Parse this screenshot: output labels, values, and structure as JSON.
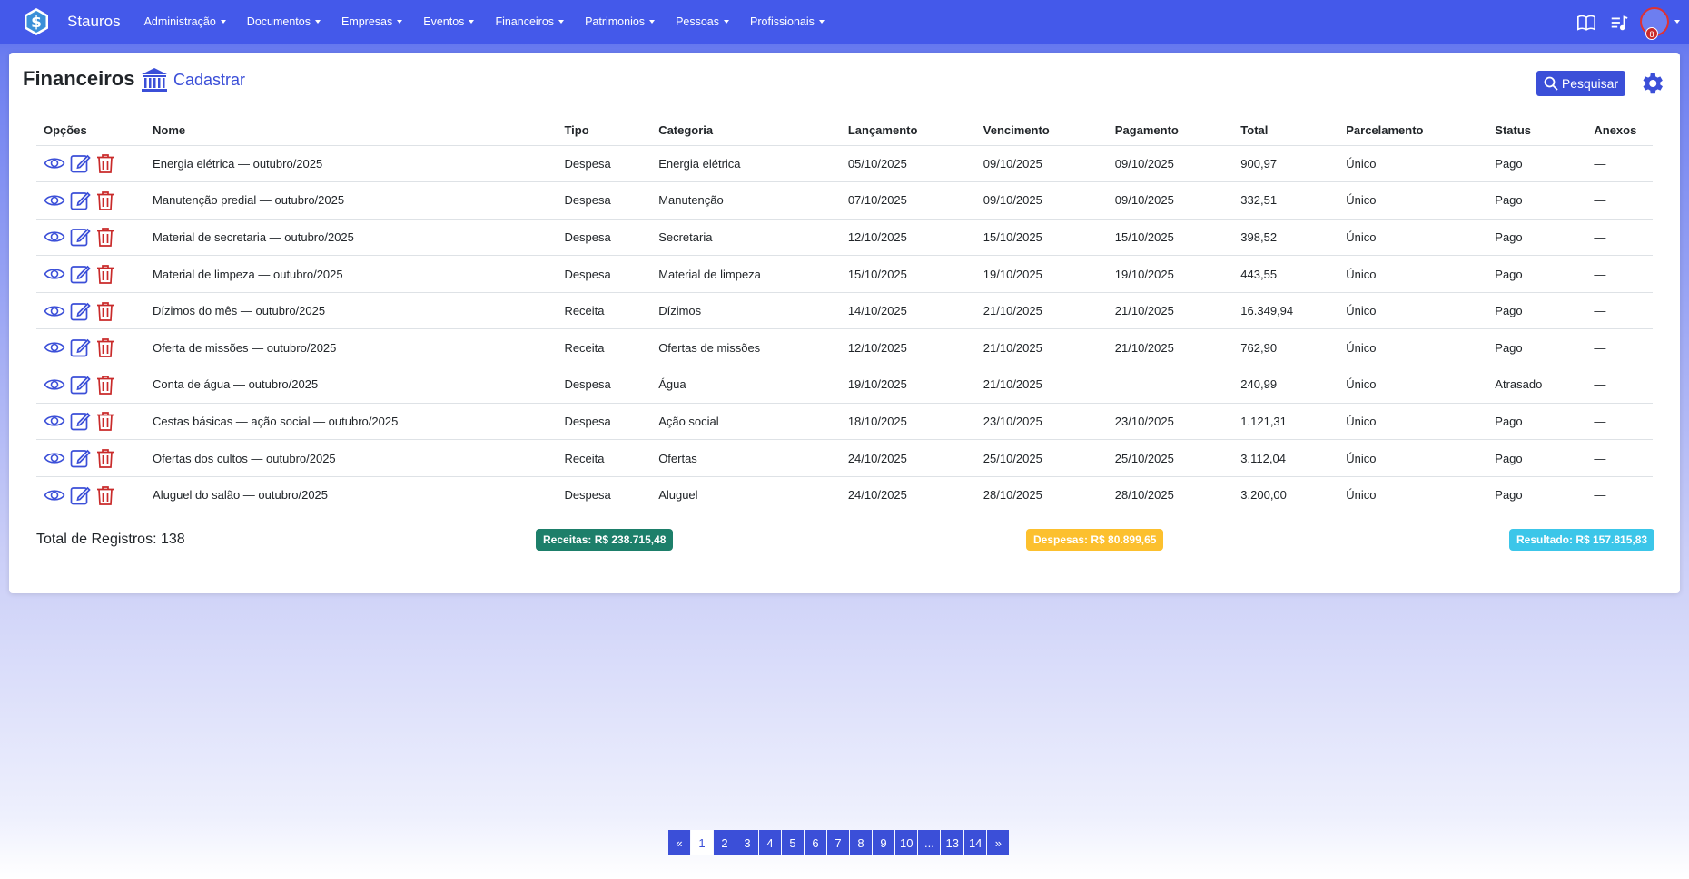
{
  "nav": {
    "brand": "Stauros",
    "menu": [
      "Administração",
      "Documentos",
      "Empresas",
      "Eventos",
      "Financeiros",
      "Patrimonios",
      "Pessoas",
      "Profissionais"
    ],
    "notification_count": "8"
  },
  "header": {
    "title": "Financeiros",
    "add_label": "Cadastrar",
    "search_label": "Pesquisar"
  },
  "table": {
    "columns": [
      "Opções",
      "Nome",
      "Tipo",
      "Categoria",
      "Lançamento",
      "Vencimento",
      "Pagamento",
      "Total",
      "Parcelamento",
      "Status",
      "Anexos"
    ],
    "rows": [
      {
        "nome": "Energia elétrica — outubro/2025",
        "tipo": "Despesa",
        "categoria": "Energia elétrica",
        "lancamento": "05/10/2025",
        "vencimento": "09/10/2025",
        "pagamento": "09/10/2025",
        "total": "900,97",
        "parcelamento": "Único",
        "status": "Pago",
        "anexos": "—"
      },
      {
        "nome": "Manutenção predial — outubro/2025",
        "tipo": "Despesa",
        "categoria": "Manutenção",
        "lancamento": "07/10/2025",
        "vencimento": "09/10/2025",
        "pagamento": "09/10/2025",
        "total": "332,51",
        "parcelamento": "Único",
        "status": "Pago",
        "anexos": "—"
      },
      {
        "nome": "Material de secretaria — outubro/2025",
        "tipo": "Despesa",
        "categoria": "Secretaria",
        "lancamento": "12/10/2025",
        "vencimento": "15/10/2025",
        "pagamento": "15/10/2025",
        "total": "398,52",
        "parcelamento": "Único",
        "status": "Pago",
        "anexos": "—"
      },
      {
        "nome": "Material de limpeza — outubro/2025",
        "tipo": "Despesa",
        "categoria": "Material de limpeza",
        "lancamento": "15/10/2025",
        "vencimento": "19/10/2025",
        "pagamento": "19/10/2025",
        "total": "443,55",
        "parcelamento": "Único",
        "status": "Pago",
        "anexos": "—"
      },
      {
        "nome": "Dízimos do mês — outubro/2025",
        "tipo": "Receita",
        "categoria": "Dízimos",
        "lancamento": "14/10/2025",
        "vencimento": "21/10/2025",
        "pagamento": "21/10/2025",
        "total": "16.349,94",
        "parcelamento": "Único",
        "status": "Pago",
        "anexos": "—"
      },
      {
        "nome": "Oferta de missões — outubro/2025",
        "tipo": "Receita",
        "categoria": "Ofertas de missões",
        "lancamento": "12/10/2025",
        "vencimento": "21/10/2025",
        "pagamento": "21/10/2025",
        "total": "762,90",
        "parcelamento": "Único",
        "status": "Pago",
        "anexos": "—"
      },
      {
        "nome": "Conta de água — outubro/2025",
        "tipo": "Despesa",
        "categoria": "Água",
        "lancamento": "19/10/2025",
        "vencimento": "21/10/2025",
        "pagamento": "",
        "total": "240,99",
        "parcelamento": "Único",
        "status": "Atrasado",
        "anexos": "—"
      },
      {
        "nome": "Cestas básicas — ação social — outubro/2025",
        "tipo": "Despesa",
        "categoria": "Ação social",
        "lancamento": "18/10/2025",
        "vencimento": "23/10/2025",
        "pagamento": "23/10/2025",
        "total": "1.121,31",
        "parcelamento": "Único",
        "status": "Pago",
        "anexos": "—"
      },
      {
        "nome": "Ofertas dos cultos — outubro/2025",
        "tipo": "Receita",
        "categoria": "Ofertas",
        "lancamento": "24/10/2025",
        "vencimento": "25/10/2025",
        "pagamento": "25/10/2025",
        "total": "3.112,04",
        "parcelamento": "Único",
        "status": "Pago",
        "anexos": "—"
      },
      {
        "nome": "Aluguel do salão — outubro/2025",
        "tipo": "Despesa",
        "categoria": "Aluguel",
        "lancamento": "24/10/2025",
        "vencimento": "28/10/2025",
        "pagamento": "28/10/2025",
        "total": "3.200,00",
        "parcelamento": "Único",
        "status": "Pago",
        "anexos": "—"
      }
    ]
  },
  "summary": {
    "total_registros": "Total de Registros: 138",
    "receitas": "Receitas: R$ 238.715,48",
    "despesas": "Despesas: R$ 80.899,65",
    "resultado": "Resultado: R$ 157.815,83"
  },
  "pagination": {
    "pages": [
      "«",
      "1",
      "2",
      "3",
      "4",
      "5",
      "6",
      "7",
      "8",
      "9",
      "10",
      "...",
      "13",
      "14",
      "»"
    ],
    "active": "1"
  },
  "colors": {
    "primary": "#3b4fd8",
    "navbar": "#4459ea",
    "delete": "#c92a2a",
    "receitas_badge": "#1d7f6a",
    "despesas_badge": "#fcc02e",
    "resultado_badge": "#3cc6e9"
  }
}
